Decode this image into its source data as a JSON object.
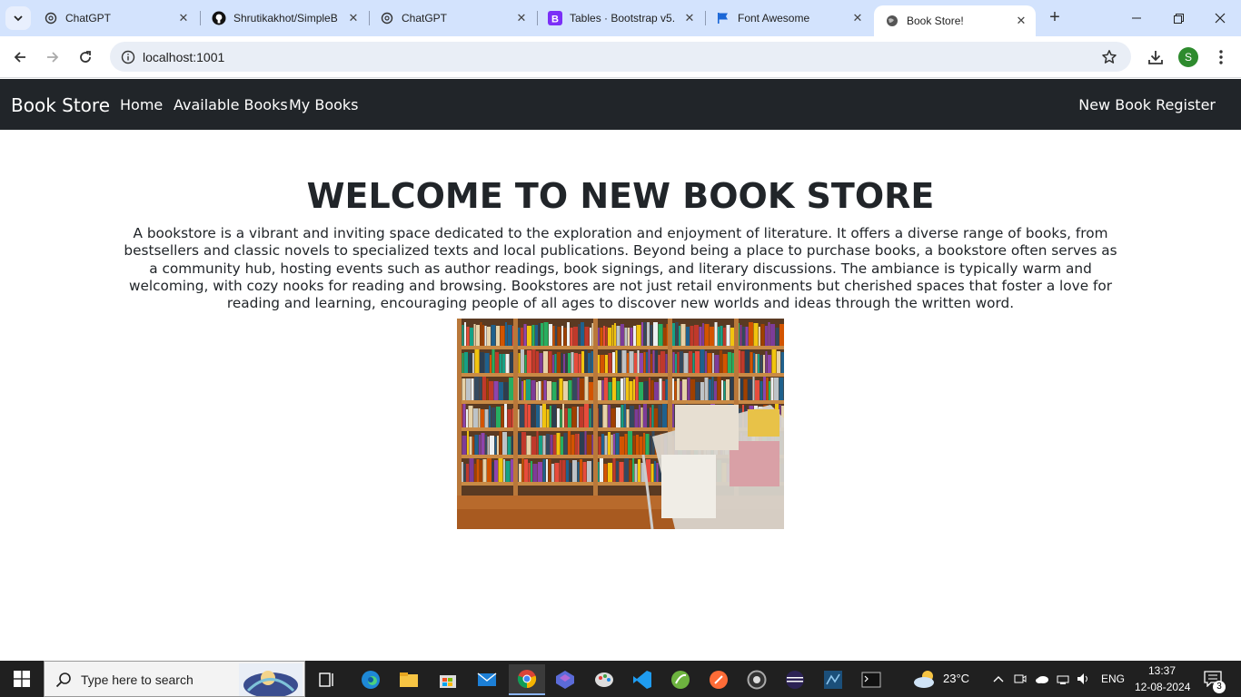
{
  "browser": {
    "tabs": [
      {
        "title": "ChatGPT",
        "icon": "chatgpt-icon"
      },
      {
        "title": "Shrutikakhot/SimpleB",
        "icon": "github-icon"
      },
      {
        "title": "ChatGPT",
        "icon": "chatgpt-icon"
      },
      {
        "title": "Tables · Bootstrap v5.",
        "icon": "bootstrap-icon"
      },
      {
        "title": "Font Awesome",
        "icon": "flag-icon"
      },
      {
        "title": "Book Store!",
        "icon": "globe-icon",
        "active": true
      }
    ],
    "url": "localhost:1001",
    "profile_initial": "S"
  },
  "page": {
    "brand": "Book Store",
    "nav": {
      "home": "Home",
      "available_books": "Available Books",
      "my_books": "My Books",
      "new_book_register": "New Book Register"
    },
    "title": "WELCOME TO NEW BOOK STORE",
    "description": "A bookstore is a vibrant and inviting space dedicated to the exploration and enjoyment of literature. It offers a diverse range of books, from bestsellers and classic novels to specialized texts and local publications. Beyond being a place to purchase books, a bookstore often serves as a community hub, hosting events such as author readings, book signings, and literary discussions. The ambiance is typically warm and welcoming, with cozy nooks for reading and browsing. Bookstores are not just retail environments but cherished spaces that foster a love for reading and learning, encouraging people of all ages to discover new worlds and ideas through the written word."
  },
  "taskbar": {
    "search_placeholder": "Type here to search",
    "weather": "23°C",
    "language": "ENG",
    "time": "13:37",
    "date": "12-08-2024",
    "notifications": "3"
  },
  "colors": {
    "navbar": "#212529",
    "tabbar": "#d3e3fd",
    "taskbar": "#202020"
  }
}
